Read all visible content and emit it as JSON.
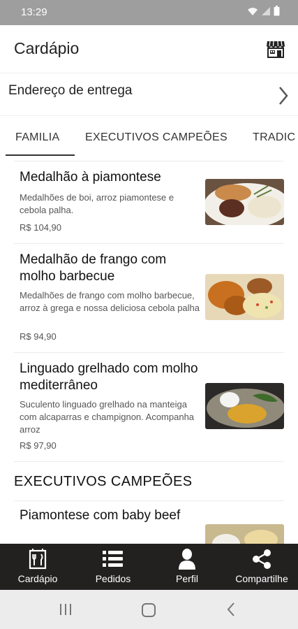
{
  "status_bar": {
    "time": "13:29"
  },
  "app_bar": {
    "title": "Cardápio",
    "store_icon": "storefront-icon"
  },
  "address": {
    "label": "Endereço de entrega"
  },
  "tabs": [
    {
      "label": "FAMILIA",
      "active": true
    },
    {
      "label": "EXECUTIVOS CAMPEÕES",
      "active": false
    },
    {
      "label": "TRADIC",
      "active": false
    }
  ],
  "menu": {
    "items": [
      {
        "title": "Medalhão à piamontese",
        "description": "Medalhões de boi, arroz piamontese e cebola palha.",
        "price": "R$ 104,90"
      },
      {
        "title": "Medalhão de frango com molho barbecue",
        "description": "Medalhões de frango com molho barbecue, arroz à grega e nossa deliciosa cebola palha",
        "price": "R$ 94,90"
      },
      {
        "title": "Linguado grelhado com molho mediterrâneo",
        "description": "Suculento linguado grelhado na manteiga com alcaparras e champignon. Acompanha arroz",
        "price": "R$ 97,90"
      }
    ],
    "section_title": "EXECUTIVOS CAMPEÕES",
    "next_item": {
      "title": "Piamontese com baby beef"
    }
  },
  "bottom_nav": [
    {
      "label": "Cardápio",
      "icon": "menu-book-icon"
    },
    {
      "label": "Pedidos",
      "icon": "list-icon"
    },
    {
      "label": "Perfil",
      "icon": "person-icon"
    },
    {
      "label": "Compartilhe",
      "icon": "share-icon"
    }
  ],
  "colors": {
    "status_bar": "#9e9e9e",
    "bottom_nav": "#232020",
    "system_nav": "#ececec",
    "text": "#1f1f1f"
  }
}
